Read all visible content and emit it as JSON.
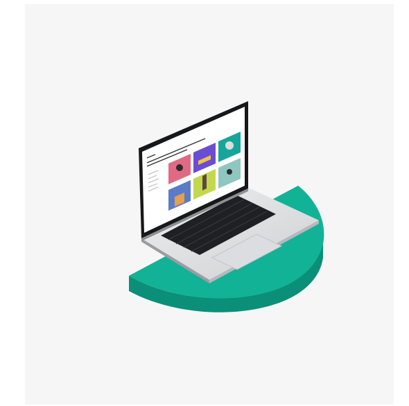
{
  "colors": {
    "background": "#ffffff",
    "panel": "#f6f6f6",
    "platform_top": "#12b296",
    "platform_side": "#0b8f78",
    "laptop_body": "#d8d9dc",
    "keyboard": "#1f2023",
    "screen_bezel": "#17181a"
  },
  "illustration": {
    "subject": "laptop-on-half-circle-platform",
    "screen_content": "portfolio-grid",
    "thumbnail_colors": [
      "#5b8ad6",
      "#6b4dd1",
      "#16a59a",
      "#e06a84",
      "#e9b04a",
      "#7ecbc2",
      "#5a7cc8",
      "#c3d84e",
      "#8fc6c0"
    ]
  }
}
